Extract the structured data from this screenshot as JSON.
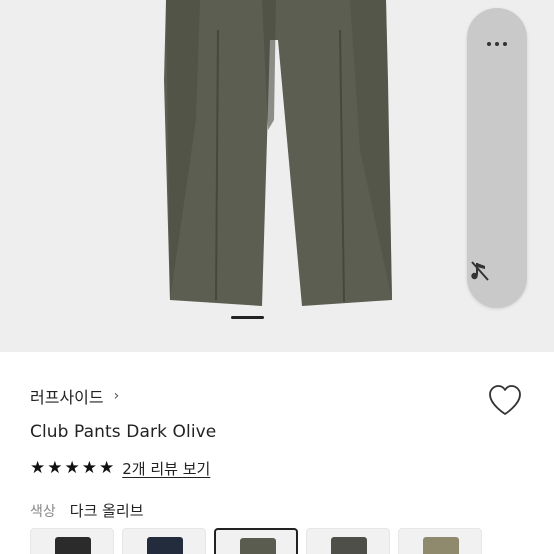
{
  "product": {
    "brand": "러프사이드",
    "brand_chevron": "›",
    "title": "Club Pants Dark Olive",
    "rating_stars": [
      "★",
      "★",
      "★",
      "★",
      "★"
    ],
    "review_link": "2개 리뷰 보기",
    "color_label": "색상",
    "color_value": "다크 올리브"
  },
  "gallery": {
    "selected_index": 0,
    "image_colors": {
      "background": "#eeeeee",
      "pants": "#5c5e51",
      "pants_shadow": "#4b4d42"
    }
  },
  "floating_actions": {
    "more_icon": "more-dots-icon",
    "mute_icon": "sound-off-icon"
  },
  "swatches": [
    {
      "name": "black",
      "color": "#2b2b2b",
      "selected": false
    },
    {
      "name": "navy",
      "color": "#232c3d",
      "selected": false
    },
    {
      "name": "dark-olive",
      "color": "#5a5c4f",
      "selected": true
    },
    {
      "name": "charcoal-olive",
      "color": "#4e4f48",
      "selected": false
    },
    {
      "name": "khaki",
      "color": "#8f8a6e",
      "selected": false
    }
  ]
}
